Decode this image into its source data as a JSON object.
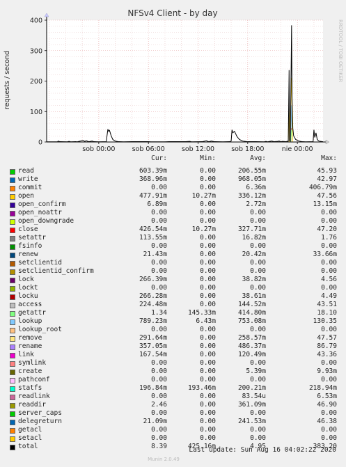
{
  "chart_data": {
    "type": "line",
    "title": "NFSv4 Client - by day",
    "ylabel": "requests / second",
    "side_text": "RRDTOOL / TOBI OETIKER",
    "ylim": [
      0,
      400
    ],
    "y_ticks": [
      "0",
      "100",
      "200",
      "300",
      "400"
    ],
    "x_ticks": [
      "sob 00:00",
      "sob 06:00",
      "sob 12:00",
      "sob 18:00",
      "nie 00:00"
    ],
    "x_tick_hours": [
      6,
      12,
      18,
      24,
      30
    ],
    "x_range_hours": [
      -0.3,
      33.1
    ],
    "grid": true,
    "series": [
      {
        "name": "total",
        "color": "#000000",
        "points": [
          [
            -0.3,
            0.5
          ],
          [
            1.0,
            0.5
          ],
          [
            1.1,
            3
          ],
          [
            1.3,
            1
          ],
          [
            2.2,
            0.5
          ],
          [
            2.4,
            2
          ],
          [
            2.6,
            0.5
          ],
          [
            3.2,
            1
          ],
          [
            3.4,
            0.5
          ],
          [
            4.1,
            5
          ],
          [
            4.3,
            2
          ],
          [
            4.5,
            4
          ],
          [
            4.8,
            1
          ],
          [
            5.2,
            3
          ],
          [
            5.4,
            1
          ],
          [
            6.0,
            0.5
          ],
          [
            6.9,
            1
          ],
          [
            7.1,
            42
          ],
          [
            7.2,
            35
          ],
          [
            7.3,
            38
          ],
          [
            7.5,
            20
          ],
          [
            7.7,
            8
          ],
          [
            8.0,
            3
          ],
          [
            8.4,
            1
          ],
          [
            9.0,
            0.5
          ],
          [
            10.0,
            1
          ],
          [
            12.0,
            1
          ],
          [
            12.3,
            0.5
          ],
          [
            14.0,
            0.5
          ],
          [
            14.5,
            1
          ],
          [
            16.5,
            1
          ],
          [
            17.0,
            2
          ],
          [
            17.2,
            0.5
          ],
          [
            18.5,
            1
          ],
          [
            19.0,
            4
          ],
          [
            19.3,
            1
          ],
          [
            19.6,
            3
          ],
          [
            20.0,
            1
          ],
          [
            21.0,
            0.5
          ],
          [
            21.8,
            1
          ],
          [
            22.0,
            3
          ],
          [
            22.1,
            40
          ],
          [
            22.2,
            30
          ],
          [
            22.4,
            35
          ],
          [
            22.7,
            18
          ],
          [
            23.0,
            8
          ],
          [
            23.4,
            3
          ],
          [
            24.0,
            1
          ],
          [
            25.0,
            1
          ],
          [
            26.0,
            0.5
          ],
          [
            26.2,
            2
          ],
          [
            26.4,
            0.5
          ],
          [
            26.9,
            3
          ],
          [
            27.2,
            1
          ],
          [
            27.6,
            2
          ],
          [
            27.8,
            3
          ],
          [
            28.0,
            1
          ],
          [
            28.2,
            2
          ],
          [
            28.6,
            1
          ],
          [
            28.9,
            3
          ],
          [
            29.0,
            236
          ],
          [
            29.05,
            5
          ],
          [
            29.15,
            3
          ],
          [
            29.3,
            383
          ],
          [
            29.35,
            150
          ],
          [
            29.45,
            45
          ],
          [
            29.55,
            20
          ],
          [
            29.8,
            8
          ],
          [
            30.2,
            3
          ],
          [
            30.6,
            1
          ],
          [
            31.0,
            0.5
          ],
          [
            31.9,
            1
          ],
          [
            32.0,
            40
          ],
          [
            32.1,
            15
          ],
          [
            32.25,
            30
          ],
          [
            32.4,
            8
          ],
          [
            32.6,
            3
          ],
          [
            33.1,
            1
          ]
        ]
      },
      {
        "name": "open",
        "color": "#ffcc00",
        "points": [
          [
            -0.3,
            0
          ],
          [
            28.9,
            0
          ],
          [
            29.0,
            150
          ],
          [
            29.05,
            0
          ],
          [
            29.3,
            210
          ],
          [
            29.4,
            0
          ],
          [
            33.1,
            0
          ]
        ]
      },
      {
        "name": "getattr",
        "color": "#99ff99",
        "points": [
          [
            -0.3,
            0
          ],
          [
            29.2,
            0
          ],
          [
            29.3,
            40
          ],
          [
            29.4,
            0
          ],
          [
            33.1,
            0
          ]
        ]
      },
      {
        "name": "lookup",
        "color": "#66b2ff",
        "points": [
          [
            -0.3,
            0
          ],
          [
            29.2,
            0
          ],
          [
            29.3,
            120
          ],
          [
            29.4,
            0
          ],
          [
            33.1,
            0
          ]
        ]
      },
      {
        "name": "close",
        "color": "#ff0000",
        "points": [
          [
            -0.3,
            0
          ],
          [
            29.2,
            0
          ],
          [
            29.3,
            45
          ],
          [
            29.4,
            0
          ],
          [
            33.1,
            0
          ]
        ]
      }
    ]
  },
  "legend": {
    "headers": {
      "cur": "Cur:",
      "min": "Min:",
      "avg": "Avg:",
      "max": "Max:"
    },
    "rows": [
      {
        "name": "read",
        "color": "#00cc00",
        "cur": "603.39m",
        "min": "0.00",
        "avg": "206.55m",
        "max": "45.93"
      },
      {
        "name": "write",
        "color": "#0066b3",
        "cur": "368.96m",
        "min": "0.00",
        "avg": "968.05m",
        "max": "42.97"
      },
      {
        "name": "commit",
        "color": "#ff8000",
        "cur": "0.00",
        "min": "0.00",
        "avg": "6.36m",
        "max": "406.79m"
      },
      {
        "name": "open",
        "color": "#ffcc00",
        "cur": "477.91m",
        "min": "10.27m",
        "avg": "336.12m",
        "max": "47.56"
      },
      {
        "name": "open_confirm",
        "color": "#330099",
        "cur": "6.89m",
        "min": "0.00",
        "avg": "2.72m",
        "max": "13.15m"
      },
      {
        "name": "open_noattr",
        "color": "#990099",
        "cur": "0.00",
        "min": "0.00",
        "avg": "0.00",
        "max": "0.00"
      },
      {
        "name": "open_downgrade",
        "color": "#ccff00",
        "cur": "0.00",
        "min": "0.00",
        "avg": "0.00",
        "max": "0.00"
      },
      {
        "name": "close",
        "color": "#ff0000",
        "cur": "426.54m",
        "min": "10.27m",
        "avg": "327.71m",
        "max": "47.20"
      },
      {
        "name": "setattr",
        "color": "#808080",
        "cur": "113.55m",
        "min": "0.00",
        "avg": "16.82m",
        "max": "1.76"
      },
      {
        "name": "fsinfo",
        "color": "#008f00",
        "cur": "0.00",
        "min": "0.00",
        "avg": "0.00",
        "max": "0.00"
      },
      {
        "name": "renew",
        "color": "#00487d",
        "cur": "21.43m",
        "min": "0.00",
        "avg": "20.42m",
        "max": "33.66m"
      },
      {
        "name": "setclientid",
        "color": "#b35a00",
        "cur": "0.00",
        "min": "0.00",
        "avg": "0.00",
        "max": "0.00"
      },
      {
        "name": "setclientid_confirm",
        "color": "#b38f00",
        "cur": "0.00",
        "min": "0.00",
        "avg": "0.00",
        "max": "0.00"
      },
      {
        "name": "lock",
        "color": "#6b006b",
        "cur": "266.39m",
        "min": "0.00",
        "avg": "38.82m",
        "max": "4.56"
      },
      {
        "name": "lockt",
        "color": "#8fb300",
        "cur": "0.00",
        "min": "0.00",
        "avg": "0.00",
        "max": "0.00"
      },
      {
        "name": "locku",
        "color": "#b30000",
        "cur": "266.28m",
        "min": "0.00",
        "avg": "38.61m",
        "max": "4.49"
      },
      {
        "name": "access",
        "color": "#bebebe",
        "cur": "224.48m",
        "min": "0.00",
        "avg": "144.52m",
        "max": "43.51"
      },
      {
        "name": "getattr",
        "color": "#80ff80",
        "cur": "1.34",
        "min": "145.33m",
        "avg": "414.80m",
        "max": "18.10"
      },
      {
        "name": "lookup",
        "color": "#80c9ff",
        "cur": "789.23m",
        "min": "6.43m",
        "avg": "753.08m",
        "max": "130.35"
      },
      {
        "name": "lookup_root",
        "color": "#ffc080",
        "cur": "0.00",
        "min": "0.00",
        "avg": "0.00",
        "max": "0.00"
      },
      {
        "name": "remove",
        "color": "#ffe680",
        "cur": "291.64m",
        "min": "0.00",
        "avg": "258.57m",
        "max": "47.57"
      },
      {
        "name": "rename",
        "color": "#aa80ff",
        "cur": "357.05m",
        "min": "0.00",
        "avg": "486.37m",
        "max": "86.79"
      },
      {
        "name": "link",
        "color": "#ee00cc",
        "cur": "167.54m",
        "min": "0.00",
        "avg": "120.49m",
        "max": "43.36"
      },
      {
        "name": "symlink",
        "color": "#ff8080",
        "cur": "0.00",
        "min": "0.00",
        "avg": "0.00",
        "max": "0.00"
      },
      {
        "name": "create",
        "color": "#666600",
        "cur": "0.00",
        "min": "0.00",
        "avg": "5.39m",
        "max": "9.93m"
      },
      {
        "name": "pathconf",
        "color": "#ffbfff",
        "cur": "0.00",
        "min": "0.00",
        "avg": "0.00",
        "max": "0.00"
      },
      {
        "name": "statfs",
        "color": "#00ffcc",
        "cur": "196.84m",
        "min": "193.46m",
        "avg": "200.21m",
        "max": "218.94m"
      },
      {
        "name": "readlink",
        "color": "#cc6699",
        "cur": "0.00",
        "min": "0.00",
        "avg": "83.54u",
        "max": "6.53m"
      },
      {
        "name": "readdir",
        "color": "#999900",
        "cur": "2.46",
        "min": "0.00",
        "avg": "361.09m",
        "max": "46.90"
      },
      {
        "name": "server_caps",
        "color": "#00cc00",
        "cur": "0.00",
        "min": "0.00",
        "avg": "0.00",
        "max": "0.00"
      },
      {
        "name": "delegreturn",
        "color": "#0066b3",
        "cur": "21.09m",
        "min": "0.00",
        "avg": "241.53m",
        "max": "46.38"
      },
      {
        "name": "getacl",
        "color": "#ff8000",
        "cur": "0.00",
        "min": "0.00",
        "avg": "0.00",
        "max": "0.00"
      },
      {
        "name": "setacl",
        "color": "#ffcc00",
        "cur": "0.00",
        "min": "0.00",
        "avg": "0.00",
        "max": "0.00"
      },
      {
        "name": "total",
        "color": "#000000",
        "cur": "8.39",
        "min": "425.16m",
        "avg": "4.95",
        "max": "383.20"
      }
    ]
  },
  "footer": {
    "last_update": "Last update: Sun Aug 16 04:02:22 2020",
    "munin_version": "Munin 2.0.49"
  }
}
